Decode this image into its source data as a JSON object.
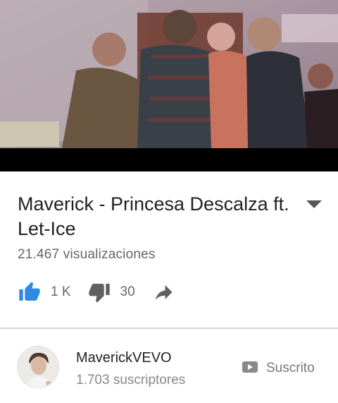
{
  "video": {
    "title": "Maverick - Princesa Descalza ft. Let-Ice",
    "views": "21.467 visualizaciones"
  },
  "actions": {
    "likes": "1 K",
    "dislikes": "30"
  },
  "channel": {
    "name": "MaverickVEVO",
    "subscribers": "1.703 suscriptores",
    "subscribe_label": "Suscrito"
  },
  "colors": {
    "like_active": "#2e8ae6",
    "icon_gray": "#606060"
  },
  "icons": {
    "expand": "chevron-down-icon",
    "like": "thumbs-up-icon",
    "dislike": "thumbs-down-icon",
    "share": "share-icon",
    "subscribe": "youtube-play-icon"
  }
}
